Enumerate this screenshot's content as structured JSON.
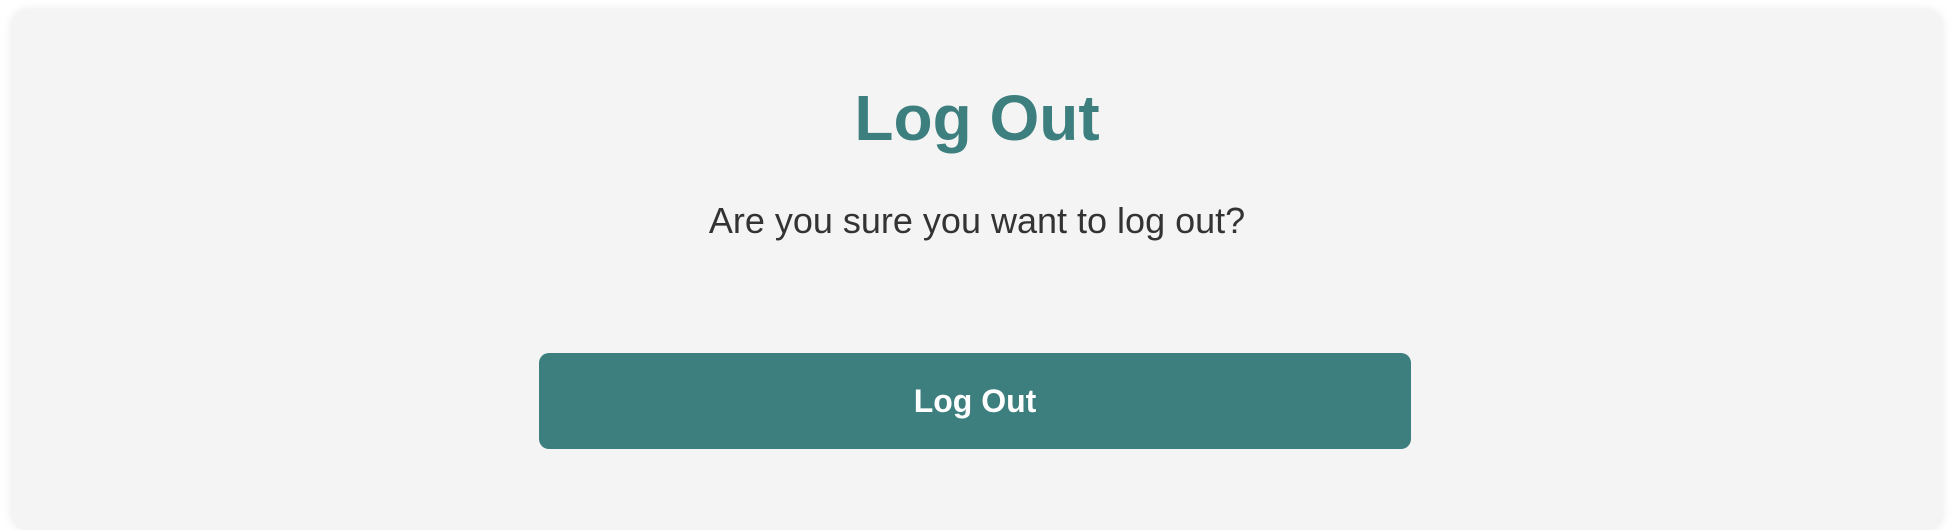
{
  "dialog": {
    "title": "Log Out",
    "message": "Are you sure you want to log out?",
    "logout_button_label": "Log Out"
  },
  "colors": {
    "accent": "#3d7f7e",
    "card_background": "#f4f4f4",
    "text": "#333333",
    "button_text": "#ffffff"
  }
}
